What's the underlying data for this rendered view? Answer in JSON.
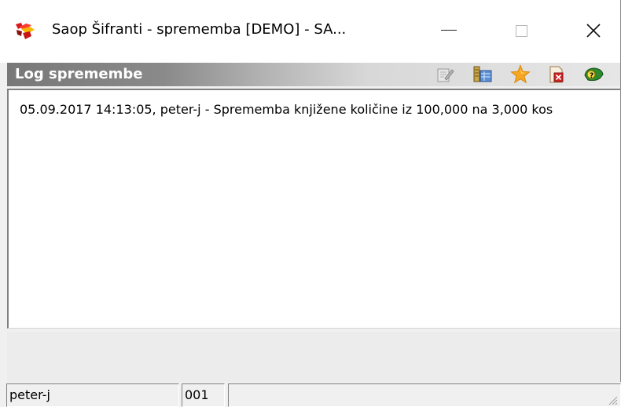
{
  "window": {
    "title": "Saop  Šifranti  - sprememba [DEMO] - SA...",
    "icon": "saop-app-icon",
    "controls": [
      "minimize-icon",
      "maximize-icon",
      "close-icon"
    ]
  },
  "header": {
    "title": "Log spremembe",
    "toolbar": [
      "edit-icon",
      "columns-icon",
      "favorite-star-icon",
      "delete-icon",
      "help-icon"
    ]
  },
  "log": {
    "text": "05.09.2017 14:13:05, peter-j - Sprememba knjižene količine iz 100,000 na 3,000 kos"
  },
  "status_bar": {
    "user": "peter-j",
    "code": "001",
    "extra": ""
  },
  "colors": {
    "header_start": "#787878",
    "header_end": "#e6e6e6",
    "window_bg": "#f0f0f0",
    "star": "#f5a623"
  }
}
